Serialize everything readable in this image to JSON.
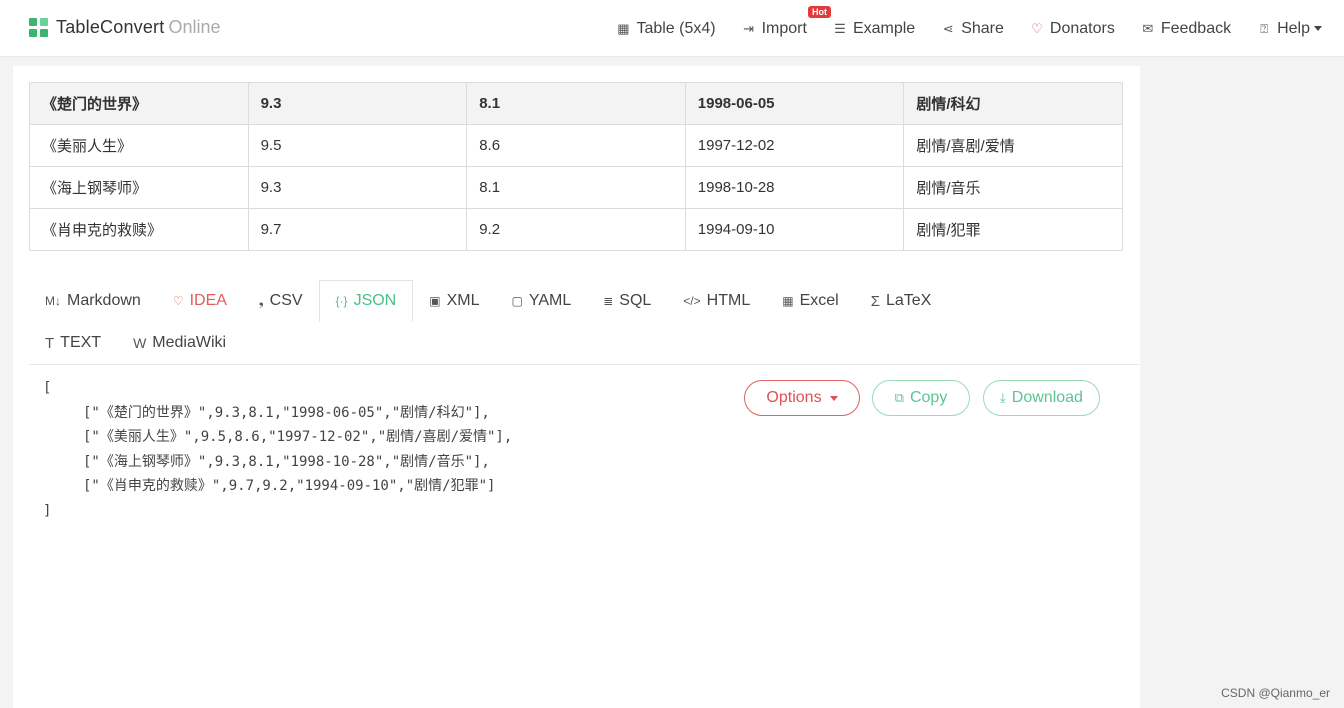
{
  "brand": {
    "name": "TableConvert",
    "sub": "Online"
  },
  "nav": [
    {
      "label": "Table (5x4)",
      "icon": "table-icon"
    },
    {
      "label": "Import",
      "icon": "import-icon",
      "badge": "Hot"
    },
    {
      "label": "Example",
      "icon": "example-icon"
    },
    {
      "label": "Share",
      "icon": "share-icon"
    },
    {
      "label": "Donators",
      "icon": "heart-icon"
    },
    {
      "label": "Feedback",
      "icon": "mail-icon"
    },
    {
      "label": "Help",
      "icon": "help-icon"
    }
  ],
  "table": {
    "header": [
      "《楚门的世界》",
      "9.3",
      "8.1",
      "1998-06-05",
      "剧情/科幻"
    ],
    "rows": [
      [
        "《美丽人生》",
        "9.5",
        "8.6",
        "1997-12-02",
        "剧情/喜剧/爱情"
      ],
      [
        "《海上钢琴师》",
        "9.3",
        "8.1",
        "1998-10-28",
        "剧情/音乐"
      ],
      [
        "《肖申克的救赎》",
        "9.7",
        "9.2",
        "1994-09-10",
        "剧情/犯罪"
      ]
    ]
  },
  "tabs": [
    {
      "label": "Markdown",
      "icon": "markdown-icon",
      "glyph": "M↓"
    },
    {
      "label": "IDEA",
      "icon": "lightbulb-icon",
      "glyph": "♡"
    },
    {
      "label": "CSV",
      "icon": "csv-icon",
      "glyph": "❟"
    },
    {
      "label": "JSON",
      "icon": "json-icon",
      "glyph": "{·}"
    },
    {
      "label": "XML",
      "icon": "xml-icon",
      "glyph": "▣"
    },
    {
      "label": "YAML",
      "icon": "yaml-icon",
      "glyph": "▢"
    },
    {
      "label": "SQL",
      "icon": "database-icon",
      "glyph": "≣"
    },
    {
      "label": "HTML",
      "icon": "code-icon",
      "glyph": "</>"
    },
    {
      "label": "Excel",
      "icon": "excel-icon",
      "glyph": "▦"
    },
    {
      "label": "LaTeX",
      "icon": "sigma-icon",
      "glyph": "Σ"
    },
    {
      "label": "TEXT",
      "icon": "text-icon",
      "glyph": "T"
    },
    {
      "label": "MediaWiki",
      "icon": "wiki-icon",
      "glyph": "W"
    }
  ],
  "active_tab": "JSON",
  "output": {
    "lines": [
      "[",
      "[\"《楚门的世界》\",9.3,8.1,\"1998-06-05\",\"剧情/科幻\"],",
      "[\"《美丽人生》\",9.5,8.6,\"1997-12-02\",\"剧情/喜剧/爱情\"],",
      "[\"《海上钢琴师》\",9.3,8.1,\"1998-10-28\",\"剧情/音乐\"],",
      "[\"《肖申克的救赎》\",9.7,9.2,\"1994-09-10\",\"剧情/犯罪\"]",
      "]"
    ]
  },
  "buttons": {
    "options": "Options",
    "copy": "Copy",
    "download": "Download"
  },
  "watermark": "CSDN @Qianmo_er",
  "colors": {
    "accent": "#49c08a",
    "danger": "#e05050",
    "brand": "#3cb371"
  }
}
